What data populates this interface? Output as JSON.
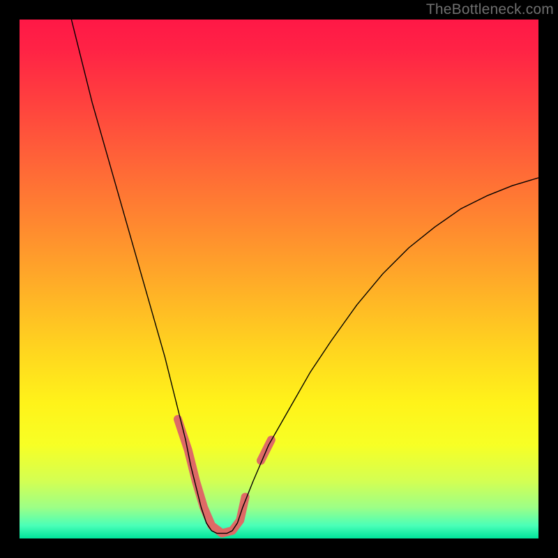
{
  "watermark": "TheBottleneck.com",
  "chart_data": {
    "type": "line",
    "title": "",
    "xlabel": "",
    "ylabel": "",
    "xlim": [
      0,
      100
    ],
    "ylim": [
      0,
      100
    ],
    "legend": false,
    "grid": false,
    "background_gradient": {
      "stops": [
        {
          "offset": 0.0,
          "color": "#ff1846"
        },
        {
          "offset": 0.06,
          "color": "#ff2345"
        },
        {
          "offset": 0.15,
          "color": "#ff3e3f"
        },
        {
          "offset": 0.27,
          "color": "#ff6338"
        },
        {
          "offset": 0.4,
          "color": "#ff8a2f"
        },
        {
          "offset": 0.52,
          "color": "#ffb027"
        },
        {
          "offset": 0.64,
          "color": "#ffd61f"
        },
        {
          "offset": 0.74,
          "color": "#fff31a"
        },
        {
          "offset": 0.82,
          "color": "#f7ff25"
        },
        {
          "offset": 0.89,
          "color": "#d3ff53"
        },
        {
          "offset": 0.94,
          "color": "#9dff86"
        },
        {
          "offset": 0.975,
          "color": "#4affb8"
        },
        {
          "offset": 1.0,
          "color": "#00e59b"
        }
      ]
    },
    "series": [
      {
        "name": "bottleneck-curve",
        "style": {
          "stroke": "#000000",
          "width": 1.4
        },
        "x": [
          10,
          12,
          14,
          16,
          18,
          20,
          22,
          24,
          26,
          28,
          30,
          31,
          32,
          33,
          34,
          35,
          36,
          37,
          38,
          39,
          40,
          41,
          42,
          43,
          45,
          48,
          52,
          56,
          60,
          65,
          70,
          75,
          80,
          85,
          90,
          95,
          100
        ],
        "y": [
          100,
          92,
          84,
          77,
          70,
          63,
          56,
          49,
          42,
          35,
          27,
          23,
          19,
          14,
          10,
          6,
          3,
          1.5,
          1,
          1,
          1,
          1.5,
          3,
          6,
          11,
          18,
          25,
          32,
          38,
          45,
          51,
          56,
          60,
          63.5,
          66,
          68,
          69.5
        ]
      },
      {
        "name": "optimal-range-marker",
        "style": {
          "stroke": "#de6a66",
          "width": 12,
          "linecap": "round"
        },
        "segments": [
          {
            "x": [
              30.5,
              32.5,
              34.0,
              35.5,
              37.0,
              39.0,
              41.0,
              42.5,
              43.5
            ],
            "y": [
              23,
              17,
              11,
              6,
              2.5,
              1.0,
              1.5,
              3.5,
              8
            ]
          },
          {
            "x": [
              46.5,
              48.5
            ],
            "y": [
              15,
              19
            ]
          }
        ]
      }
    ]
  }
}
